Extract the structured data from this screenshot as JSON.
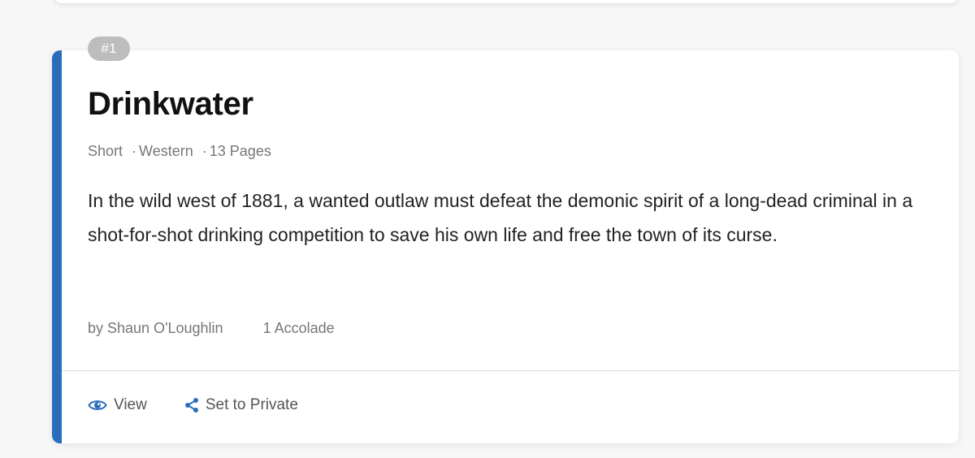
{
  "theme": {
    "accent": "#2a6ebb",
    "badge_bg": "#bdbdbd"
  },
  "entry": {
    "rank": "#1",
    "title": "Drinkwater",
    "format": "Short",
    "genre": "Western",
    "pages": "13 Pages",
    "separator": "·",
    "logline": "In the wild west of 1881, a wanted outlaw must defeat the demonic spirit of a long-dead criminal in a shot-for-shot drinking competition to save his own life and free the town of its curse.",
    "author": "by Shaun O'Loughlin",
    "accolades": "1 Accolade"
  },
  "actions": {
    "view": {
      "label": "View",
      "icon": "eye-icon"
    },
    "privacy": {
      "label": "Set to Private",
      "icon": "share-icon"
    }
  }
}
